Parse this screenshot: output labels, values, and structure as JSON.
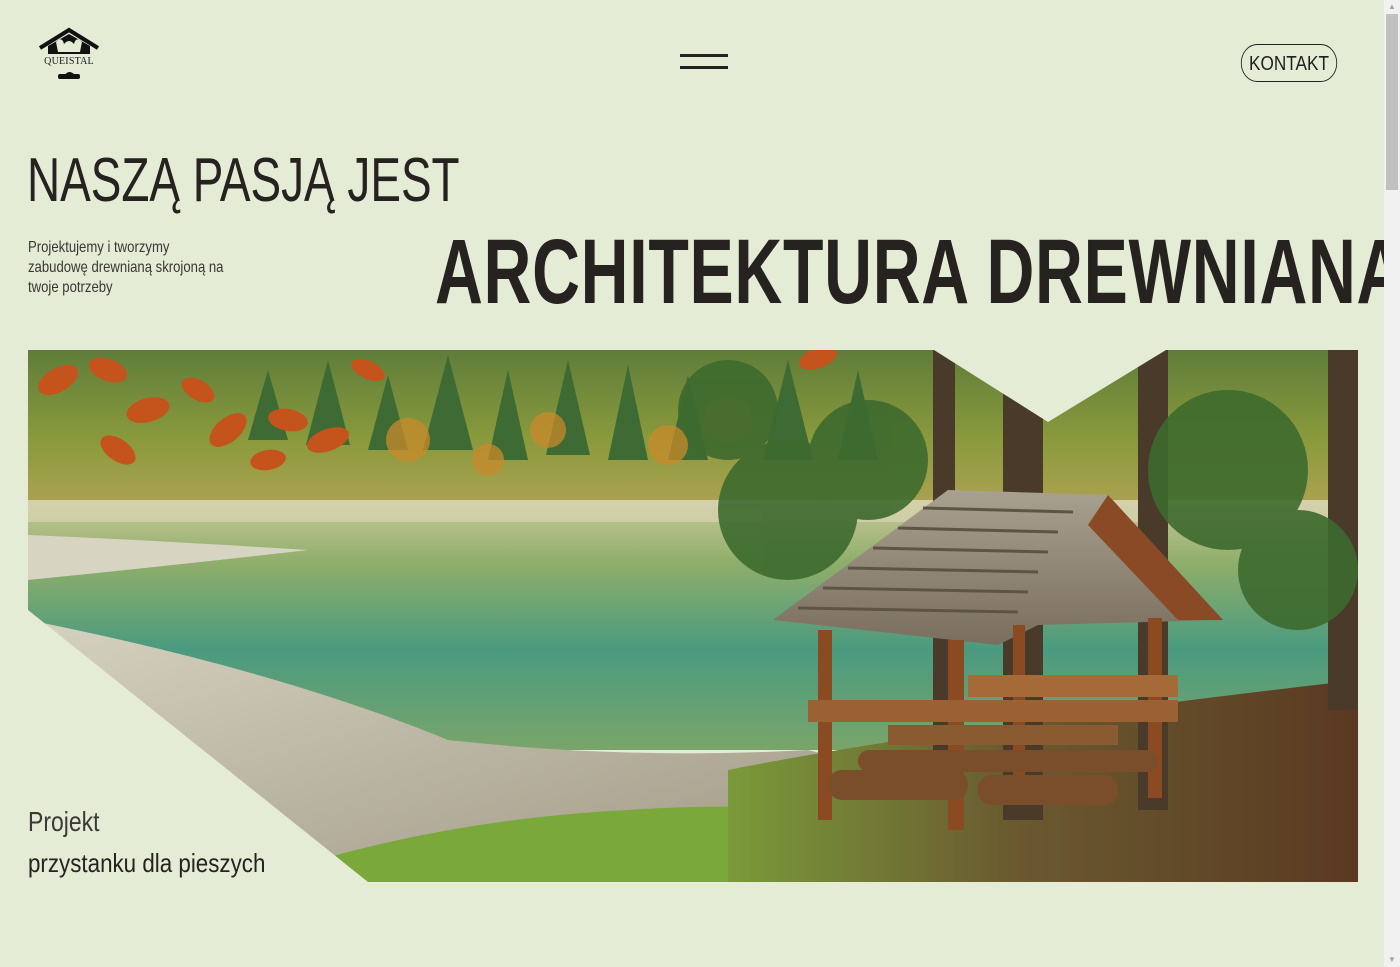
{
  "header": {
    "logo_text": "QUEISTAL",
    "menu_icon": "hamburger-icon",
    "contact_label": "KONTAKT"
  },
  "hero": {
    "headline_small": "NASZĄ PASJĄ JEST",
    "description": "Projektujemy i tworzymy zabudowę drewnianą skrojoną na twoje potrzeby",
    "headline_big": "ARCHITEKTURA DREWNIANA"
  },
  "feature": {
    "project_label": "Projekt",
    "project_name": "przystanku dla pieszych"
  },
  "colors": {
    "background": "#e4ecd6",
    "text": "#262220"
  }
}
